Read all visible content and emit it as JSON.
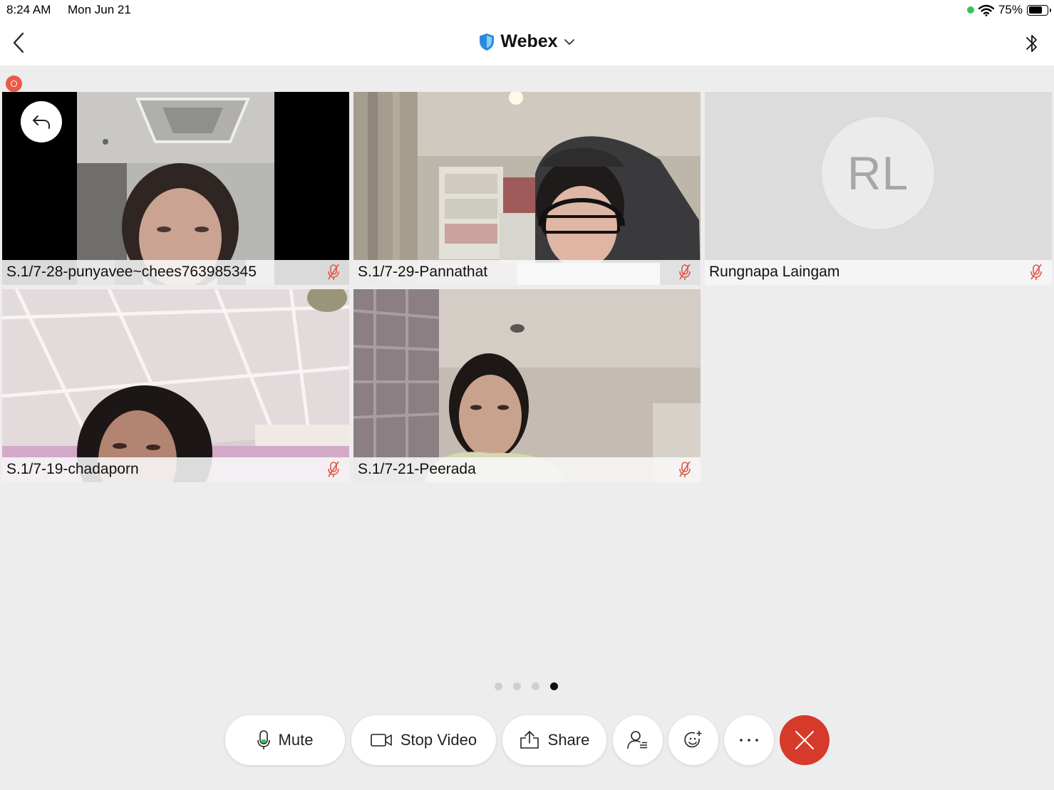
{
  "status_bar": {
    "time": "8:24 AM",
    "date": "Mon Jun 21",
    "battery": "75%",
    "battery_level": 0.75
  },
  "header": {
    "title": "Webex"
  },
  "participants": [
    {
      "name": "S.1/7-28-punyavee~chees763985345",
      "muted": true,
      "video": true
    },
    {
      "name": "S.1/7-29-Pannathat",
      "muted": true,
      "video": true
    },
    {
      "name": "Rungnapa Laingam",
      "muted": true,
      "video": false,
      "initials": "RL"
    },
    {
      "name": "S.1/7-19-chadaporn",
      "muted": true,
      "video": true
    },
    {
      "name": "S.1/7-21-Peerada",
      "muted": true,
      "video": true
    }
  ],
  "pagination": {
    "pages": 4,
    "current": 4
  },
  "controls": {
    "mute": "Mute",
    "stop_video": "Stop Video",
    "share": "Share"
  },
  "colors": {
    "end_call": "#d63a2a",
    "recording": "#ea5a47",
    "mute_icon": "#e05545",
    "webex_shield": "#2b8cdf"
  }
}
